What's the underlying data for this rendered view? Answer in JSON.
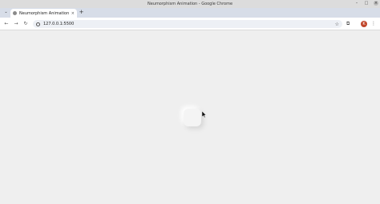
{
  "window": {
    "title": "Neumorphism Animation - Google Chrome",
    "controls": {
      "minimize": "–",
      "maximize": "□",
      "close": "×"
    }
  },
  "tabs": {
    "list_icon": "⌄",
    "items": [
      {
        "label": "Neumorphism Animation",
        "close": "×",
        "favicon": "globe-icon"
      }
    ],
    "new_tab": "+"
  },
  "toolbar": {
    "back": "←",
    "forward": "→",
    "reload": "↻",
    "url": "127.0.0.1:5500",
    "star": "☆",
    "extensions": "⧉",
    "avatar_letter": "K",
    "menu": "⋮"
  },
  "colors": {
    "page_background": "#efefef",
    "avatar": "#c0452a",
    "tabstrip": "#d7dde8"
  }
}
